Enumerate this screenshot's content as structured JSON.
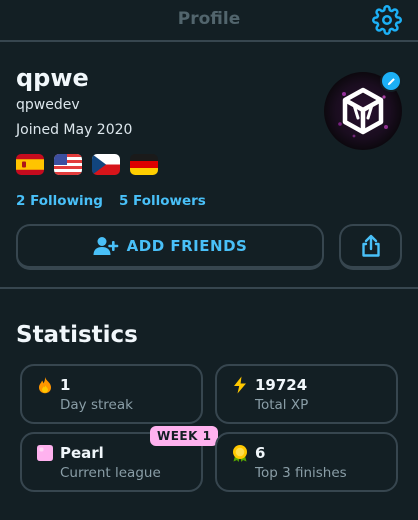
{
  "header": {
    "title": "Profile",
    "settings_icon": "gear-icon"
  },
  "profile": {
    "name": "qpwe",
    "username": "qpwedev",
    "joined": "Joined May 2020",
    "flags": [
      "spain-flag",
      "usa-flag",
      "czech-flag",
      "germany-flag"
    ],
    "following": "2 Following",
    "followers": "5 Followers",
    "avatar_icon": "cube-avatar"
  },
  "actions": {
    "add_friends": "ADD FRIENDS",
    "share_icon": "share-icon"
  },
  "statistics": {
    "title": "Statistics",
    "cards": [
      {
        "icon": "fire-icon",
        "value": "1",
        "label": "Day streak"
      },
      {
        "icon": "lightning-icon",
        "value": "19724",
        "label": "Total XP"
      },
      {
        "icon": "pearl-league-icon",
        "value": "Pearl",
        "label": "Current league",
        "badge": "WEEK 1"
      },
      {
        "icon": "medal-icon",
        "value": "6",
        "label": "Top 3 finishes"
      }
    ]
  },
  "colors": {
    "background": "#131f24",
    "accent": "#49c0f8",
    "border": "#37464f",
    "badge": "#ffb2ef"
  }
}
